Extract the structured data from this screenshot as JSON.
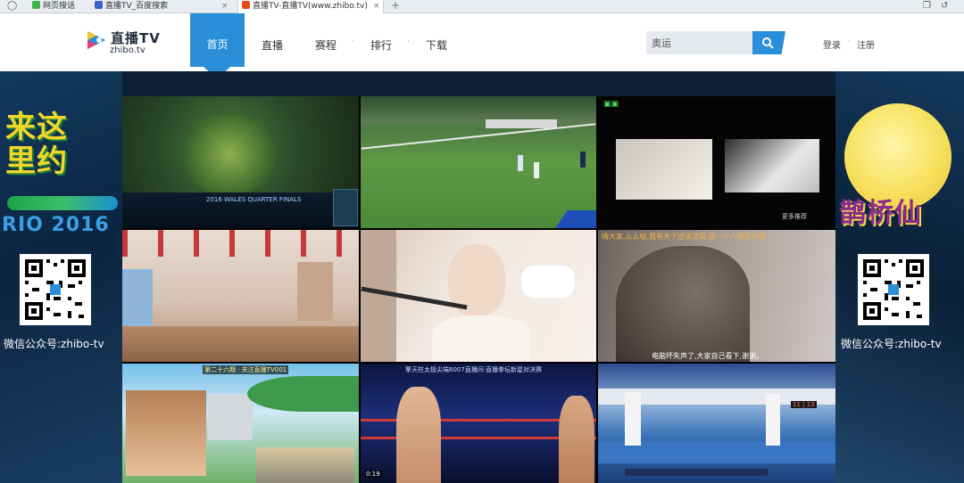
{
  "browser": {
    "tabs": [
      {
        "label": "网页搜话",
        "favicon_color": "#3bb54a"
      },
      {
        "label": "直播TV_百度搜索",
        "favicon_color": "#3a5fd0"
      },
      {
        "label": "直播TV-直播TV(www.zhibo.tv)",
        "favicon_color": "#e64a19",
        "active": true
      }
    ],
    "new_tab": "+",
    "close_glyph": "×"
  },
  "site": {
    "logo_text": "直播TV",
    "logo_sub": "zhibo.tv",
    "nav": [
      {
        "label": "首页",
        "active": true
      },
      {
        "label": "直播"
      },
      {
        "label": "赛程"
      },
      {
        "label": "排行"
      },
      {
        "label": "下载"
      }
    ],
    "nav_sep": "·",
    "search": {
      "value": "奥运",
      "icon": "search-icon"
    },
    "login": "登录",
    "register": "注册",
    "auth_sep": "·"
  },
  "left_banner": {
    "title_line1": "来这",
    "title_line2": "里约",
    "year_text": "RIO 2016",
    "qr_caption": "微信公众号:zhibo-tv"
  },
  "right_banner": {
    "title": "鹊桥仙",
    "qr_caption": "微信公众号:zhibo-tv"
  },
  "video_grid": {
    "cells": [
      {
        "id": "lol",
        "hud_text": "2016 WALES QUARTER FINALS"
      },
      {
        "id": "soccer"
      },
      {
        "id": "classroom",
        "caption": "更多推荐"
      },
      {
        "id": "dance-studio"
      },
      {
        "id": "singer"
      },
      {
        "id": "closeup",
        "subtitle_top": "嗨大家,么么哒,我有天下迹读法网,我一个人很乐乐哦",
        "subtitle_bottom": "电脑坏失声了,大家自己看下,谢谢。"
      },
      {
        "id": "cartoon-beach",
        "banner_text": "第二十六期 · 关注直播TV001"
      },
      {
        "id": "boxing",
        "banner_text": "擎天柱太极尖端6007直播间·直播拳坛新星对决赛",
        "score_text": "0:19"
      },
      {
        "id": "fencing",
        "score_text": "11 | 13"
      }
    ]
  },
  "colors": {
    "accent": "#2a8ed8",
    "dark_bg": "#0d1f33"
  }
}
